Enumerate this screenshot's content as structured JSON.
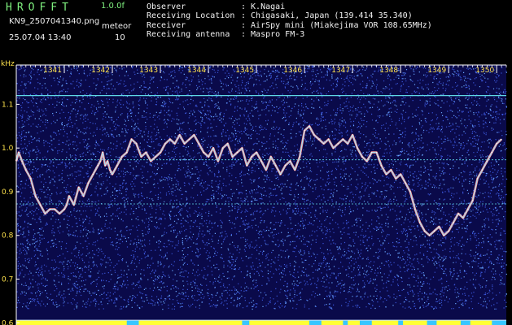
{
  "header": {
    "app_title": "HROFFT",
    "version": "1.0.0f",
    "file_name": "KN9_2507041340.png",
    "meteor_label": "meteor",
    "timestamp": "25.07.04 13:40",
    "meteor_count": "10",
    "info": [
      {
        "key": "Observer",
        "value": ": K.Nagai"
      },
      {
        "key": "Receiving Location",
        "value": ": Chigasaki, Japan (139.414 35.340)"
      },
      {
        "key": "Receiver",
        "value": ": AirSpy mini (Miakejima VOR 108.65MHz)"
      },
      {
        "key": "Receiving antenna",
        "value": ": Maspro FM-3"
      }
    ]
  },
  "colors": {
    "background": "#0a0a4a",
    "noise_a": "#3a55d8",
    "noise_b": "#6aa8ff",
    "horizontal_line": "#5fd8e6",
    "trace": "#ff9a9a",
    "trace_core": "#9be7ff",
    "power_bar": "#ffff33",
    "power_low": "#36c6ff",
    "header_text": "#7ff07f",
    "axis_text": "#ffe34d"
  },
  "chart_data": {
    "type": "line",
    "title": "",
    "xlabel": "",
    "ylabel": "kHz",
    "x_ticks": [
      "1341",
      "1342",
      "1343",
      "1344",
      "1345",
      "1346",
      "1347",
      "1348",
      "1349",
      "1350"
    ],
    "y_ticks": [
      "1.1",
      "1.0",
      "0.9",
      "0.8",
      "0.7",
      "0.6"
    ],
    "ylim": [
      0.595,
      1.19
    ],
    "xlim": [
      1340.0,
      1350.2
    ],
    "horizontal_lines_khz": [
      1.12,
      0.973,
      0.872
    ],
    "series": [
      {
        "x": [
          1340.0,
          1340.05,
          1340.12,
          1340.2,
          1340.3,
          1340.4,
          1340.5,
          1340.6,
          1340.7,
          1340.8,
          1340.9,
          1341.0,
          1341.05,
          1341.1,
          1341.2,
          1341.3,
          1341.4,
          1341.5,
          1341.6,
          1341.7,
          1341.75,
          1341.8,
          1341.85,
          1341.9,
          1341.95,
          1342.0,
          1342.1,
          1342.2,
          1342.3,
          1342.4,
          1342.5,
          1342.6,
          1342.7,
          1342.8,
          1342.9,
          1343.0,
          1343.1,
          1343.2,
          1343.3,
          1343.4,
          1343.5,
          1343.6,
          1343.7,
          1343.8,
          1343.9,
          1344.0,
          1344.1,
          1344.2,
          1344.3,
          1344.4,
          1344.5,
          1344.6,
          1344.7,
          1344.8,
          1344.9,
          1345.0,
          1345.1,
          1345.2,
          1345.3,
          1345.4,
          1345.5,
          1345.6,
          1345.7,
          1345.8,
          1345.9,
          1346.0,
          1346.1,
          1346.2,
          1346.3,
          1346.4,
          1346.5,
          1346.6,
          1346.7,
          1346.8,
          1346.9,
          1347.0,
          1347.1,
          1347.2,
          1347.3,
          1347.4,
          1347.5,
          1347.6,
          1347.7,
          1347.8,
          1347.9,
          1348.0,
          1348.1,
          1348.2,
          1348.3,
          1348.4,
          1348.5,
          1348.6,
          1348.7,
          1348.8,
          1348.9,
          1349.0,
          1349.1,
          1349.2,
          1349.3,
          1349.4,
          1349.5,
          1349.6,
          1349.7,
          1349.8,
          1349.9,
          1350.0,
          1350.1
        ],
        "values": [
          0.97,
          0.99,
          0.97,
          0.95,
          0.93,
          0.89,
          0.87,
          0.85,
          0.86,
          0.86,
          0.85,
          0.86,
          0.87,
          0.89,
          0.87,
          0.91,
          0.89,
          0.92,
          0.94,
          0.96,
          0.97,
          0.99,
          0.96,
          0.97,
          0.95,
          0.94,
          0.96,
          0.98,
          0.99,
          1.02,
          1.01,
          0.98,
          0.99,
          0.97,
          0.98,
          0.99,
          1.01,
          1.02,
          1.01,
          1.03,
          1.01,
          1.02,
          1.03,
          1.01,
          0.99,
          0.98,
          1.0,
          0.97,
          1.0,
          1.01,
          0.98,
          0.99,
          1.0,
          0.96,
          0.98,
          0.99,
          0.97,
          0.95,
          0.98,
          0.96,
          0.94,
          0.96,
          0.97,
          0.95,
          0.98,
          1.04,
          1.05,
          1.03,
          1.02,
          1.01,
          1.02,
          1.0,
          1.01,
          1.02,
          1.01,
          1.03,
          1.0,
          0.98,
          0.97,
          0.99,
          0.99,
          0.96,
          0.94,
          0.95,
          0.93,
          0.94,
          0.92,
          0.9,
          0.86,
          0.83,
          0.81,
          0.8,
          0.81,
          0.82,
          0.8,
          0.81,
          0.83,
          0.85,
          0.84,
          0.86,
          0.88,
          0.93,
          0.95,
          0.97,
          0.99,
          1.01,
          1.02
        ]
      }
    ],
    "power_baseline_y": 0.606,
    "power_gaps_x": [
      [
        1342.3,
        1342.55
      ],
      [
        1344.7,
        1344.85
      ],
      [
        1346.1,
        1346.35
      ],
      [
        1346.8,
        1346.9
      ],
      [
        1347.15,
        1347.4
      ],
      [
        1347.95,
        1348.05
      ],
      [
        1348.55,
        1348.75
      ],
      [
        1349.25,
        1349.45
      ],
      [
        1349.9,
        1350.2
      ]
    ],
    "grid": false
  }
}
